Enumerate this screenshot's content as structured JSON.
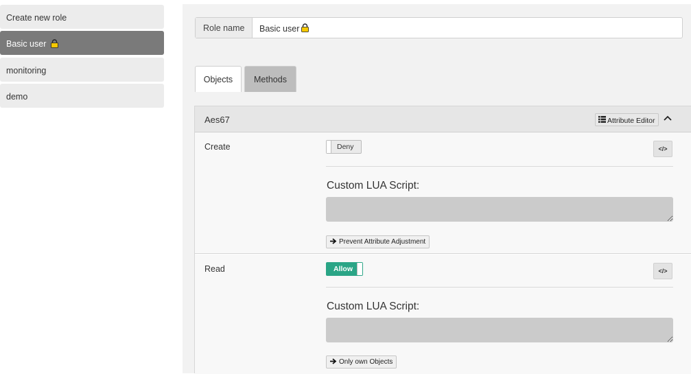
{
  "sidebar": {
    "items": [
      {
        "label": "Create new role",
        "locked": false,
        "active": false
      },
      {
        "label": "Basic user",
        "locked": true,
        "active": true
      },
      {
        "label": "monitoring",
        "locked": false,
        "active": false
      },
      {
        "label": "demo",
        "locked": false,
        "active": false
      }
    ]
  },
  "role": {
    "label": "Role name",
    "value": "Basic user"
  },
  "tabs": [
    {
      "label": "Objects",
      "active": true
    },
    {
      "label": "Methods",
      "active": false
    }
  ],
  "panel": {
    "title": "Aes67",
    "attribute_editor_label": "Attribute Editor",
    "rows": [
      {
        "label": "Create",
        "toggle_label": "Deny",
        "toggle_state": "deny",
        "code_label": "</>",
        "lua_label": "Custom LUA Script:",
        "action_label": "Prevent Attribute Adjustment"
      },
      {
        "label": "Read",
        "toggle_label": "Allow",
        "toggle_state": "allow",
        "code_label": "</>",
        "lua_label": "Custom LUA Script:",
        "action_label": "Only own Objects"
      }
    ]
  },
  "colors": {
    "allow": "#2aa586",
    "active_sidebar": "#7a7a7a",
    "lock": "#f5c800"
  },
  "icons": [
    "lock-icon",
    "list-icon",
    "chevron-up-icon",
    "code-icon",
    "arrow-right-icon"
  ]
}
